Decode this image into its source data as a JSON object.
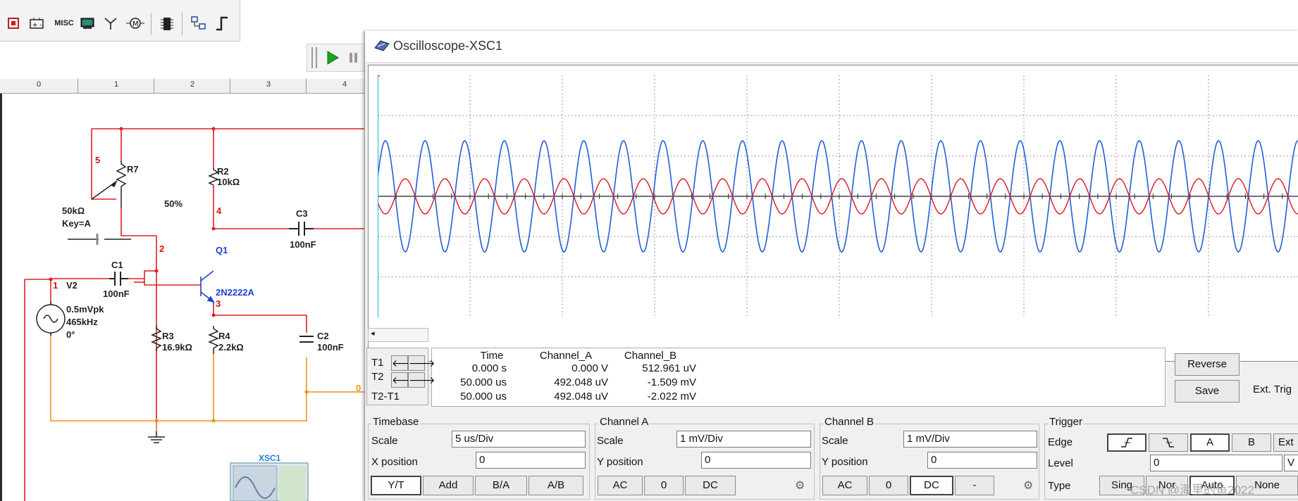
{
  "toolbar": {
    "icons": [
      "mixed-components-icon",
      "power-source-icon",
      "misc-icon",
      "indicator-icon",
      "antenna-icon",
      "electromechanical-icon",
      "mcu-icon",
      "hierarchy-icon",
      "bus-icon"
    ],
    "misc_label": "MISC"
  },
  "simulation": {
    "run_icon": "play-icon",
    "pause_icon": "pause-icon"
  },
  "ruler": {
    "labels": [
      "0",
      "1",
      "2",
      "3",
      "4"
    ]
  },
  "schematic": {
    "components": {
      "r7": "R7",
      "r7_value": "50kΩ",
      "r7_key": "Key=A",
      "r7_pct": "50%",
      "r2": "R2",
      "r2_value": "10kΩ",
      "c3": "C3",
      "c3_value": "100nF",
      "q1": "Q1",
      "q1_model": "2N2222A",
      "c1": "C1",
      "c1_value": "100nF",
      "v2": "V2",
      "v2_amp": "0.5mVpk",
      "v2_freq": "465kHz",
      "v2_phase": "0°",
      "r3": "R3",
      "r3_value": "16.9kΩ",
      "r4": "R4",
      "r4_value": "2.2kΩ",
      "c2": "C2",
      "c2_value": "100nF",
      "xsc": "XSC1"
    },
    "nets": {
      "n5": "5",
      "n4": "4",
      "n2": "2",
      "n1": "1",
      "n3": "3",
      "n0": "0"
    }
  },
  "oscilloscope": {
    "title": "Oscilloscope-XSC1",
    "channel_colors": {
      "a": "#e0141e",
      "b": "#1f5fd8"
    },
    "readout": {
      "headers": [
        "Time",
        "Channel_A",
        "Channel_B"
      ],
      "rows": [
        {
          "label": "T1",
          "time": "0.000 s",
          "a": "0.000 V",
          "b": "512.961 uV"
        },
        {
          "label": "T2",
          "time": "50.000 us",
          "a": "492.048 uV",
          "b": "-1.509 mV"
        },
        {
          "label": "T2-T1",
          "time": "50.000 us",
          "a": "492.048 uV",
          "b": "-2.022 mV"
        }
      ]
    },
    "buttons": {
      "reverse": "Reverse",
      "save": "Save",
      "ext_trigger": "Ext. Trig"
    },
    "timebase": {
      "title": "Timebase",
      "scale_label": "Scale",
      "scale": "5 us/Div",
      "xpos_label": "X position",
      "xpos": "0",
      "modes": [
        "Y/T",
        "Add",
        "B/A",
        "A/B"
      ]
    },
    "channel_a": {
      "title": "Channel A",
      "scale_label": "Scale",
      "scale": "1 mV/Div",
      "ypos_label": "Y position",
      "ypos": "0",
      "coupling": [
        "AC",
        "0",
        "DC"
      ]
    },
    "channel_b": {
      "title": "Channel B",
      "scale_label": "Scale",
      "scale": "1 mV/Div",
      "ypos_label": "Y position",
      "ypos": "0",
      "coupling": [
        "AC",
        "0",
        "DC",
        "-"
      ]
    },
    "trigger": {
      "title": "Trigger",
      "edge_label": "Edge",
      "edges": [
        "rising-edge-icon",
        "falling-edge-icon"
      ],
      "sources": [
        "A",
        "B",
        "Ext"
      ],
      "level_label": "Level",
      "level": "0",
      "level_unit": "V",
      "type_label": "Type",
      "types": [
        "Sing",
        "Nor",
        "Auto",
        "None"
      ]
    }
  },
  "watermark": "CSDN @海里的鱼2022"
}
